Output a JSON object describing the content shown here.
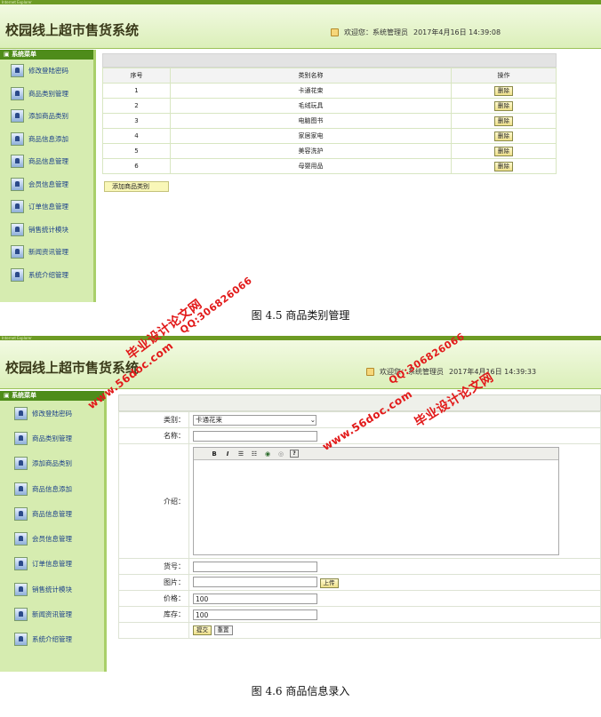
{
  "top_strip": "Internet Explorer",
  "app_title": "校园线上超市售货系统",
  "welcome_1": "欢迎您：系统管理员",
  "datetime_1": "2017年4月16日  14:39:08",
  "welcome_2": "欢迎您：系统管理员",
  "datetime_2": "2017年4月16日  14:39:33",
  "menu_title": "系统菜单",
  "menu_items": [
    "修改登陆密码",
    "商品类别管理",
    "添加商品类别",
    "商品信息添加",
    "商品信息管理",
    "会员信息管理",
    "订单信息管理",
    "销售统计模块",
    "新闻资讯管理",
    "系统介绍管理"
  ],
  "category_table": {
    "headers": [
      "序号",
      "类别名称",
      "操作"
    ],
    "rows": [
      {
        "no": "1",
        "name": "卡通花束",
        "action": "删除"
      },
      {
        "no": "2",
        "name": "毛绒玩具",
        "action": "删除"
      },
      {
        "no": "3",
        "name": "电脑图书",
        "action": "删除"
      },
      {
        "no": "4",
        "name": "家居家电",
        "action": "删除"
      },
      {
        "no": "5",
        "name": "美容洗护",
        "action": "删除"
      },
      {
        "no": "6",
        "name": "母婴用品",
        "action": "删除"
      }
    ]
  },
  "add_category_button": "添加商品类别",
  "caption_1": "图 4.5  商品类别管理",
  "form": {
    "category_label": "类别：",
    "category_value": "卡通花束",
    "name_label": "名称：",
    "intro_label": "介绍：",
    "sku_label": "货号：",
    "image_label": "图片：",
    "upload_button": "上传",
    "price_label": "价格：",
    "price_value": "100",
    "stock_label": "库存：",
    "stock_value": "100",
    "submit_button": "提交",
    "reset_button": "重置"
  },
  "caption_2": "图 4.6  商品信息录入",
  "watermarks": {
    "site_name": "毕业设计论文网",
    "url": "www.56doc.com",
    "qq": "QQ:306826066"
  }
}
